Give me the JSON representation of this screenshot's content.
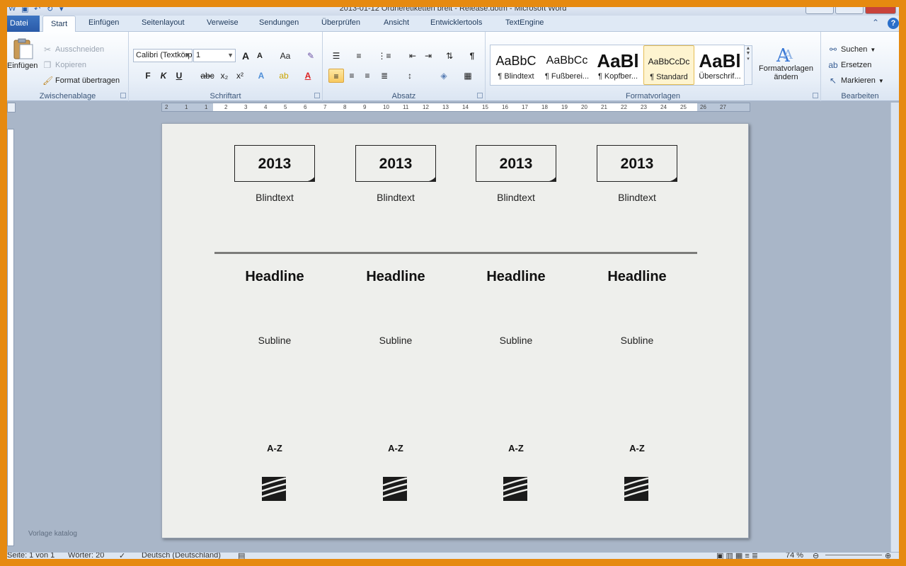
{
  "window": {
    "title": "2013-01-12 Ordneretiketten breit - Release.dotm - Microsoft Word"
  },
  "tabs": [
    {
      "label": "Datei"
    },
    {
      "label": "Start"
    },
    {
      "label": "Einfügen"
    },
    {
      "label": "Seitenlayout"
    },
    {
      "label": "Verweise"
    },
    {
      "label": "Sendungen"
    },
    {
      "label": "Überprüfen"
    },
    {
      "label": "Ansicht"
    },
    {
      "label": "Entwicklertools"
    },
    {
      "label": "TextEngine"
    }
  ],
  "ribbon": {
    "clipboard": {
      "group_label": "Zwischenablage",
      "paste_label": "Einfügen",
      "cut_label": "Ausschneiden",
      "copy_label": "Kopieren",
      "format_painter_label": "Format übertragen"
    },
    "font": {
      "group_label": "Schriftart",
      "font_name": "Calibri (Textkörper)",
      "font_size": "1",
      "bold": "F",
      "italic": "K",
      "underline": "U",
      "strike": "abc",
      "subscript": "x₂",
      "superscript": "x²",
      "change_case": "Aa",
      "grow": "A",
      "shrink": "A"
    },
    "paragraph": {
      "group_label": "Absatz",
      "pilcrow": "¶"
    },
    "styles": {
      "group_label": "Formatvorlagen",
      "items": [
        {
          "sample": "AaBbC",
          "name": "¶ Blindtext"
        },
        {
          "sample": "AaBbCc",
          "name": "¶ Fußberei..."
        },
        {
          "sample": "AaBl",
          "name": "¶ Kopfber..."
        },
        {
          "sample": "AaBbCcDc",
          "name": "¶ Standard"
        },
        {
          "sample": "AaBl",
          "name": "Überschrif..."
        }
      ],
      "change_styles_label_1": "Formatvorlagen",
      "change_styles_label_2": "ändern"
    },
    "editing": {
      "group_label": "Bearbeiten",
      "find_label": "Suchen",
      "replace_label": "Ersetzen",
      "select_label": "Markieren"
    }
  },
  "ruler": {
    "numbers": [
      "2",
      "1",
      "1",
      "2",
      "3",
      "4",
      "5",
      "6",
      "7",
      "8",
      "9",
      "10",
      "11",
      "12",
      "13",
      "14",
      "15",
      "16",
      "17",
      "18",
      "19",
      "20",
      "21",
      "22",
      "23",
      "24",
      "25",
      "26",
      "27"
    ]
  },
  "document": {
    "labels": [
      {
        "year": "2013",
        "blindtext": "Blindtext",
        "headline": "Headline",
        "subline": "Subline",
        "az": "A-Z"
      },
      {
        "year": "2013",
        "blindtext": "Blindtext",
        "headline": "Headline",
        "subline": "Subline",
        "az": "A-Z"
      },
      {
        "year": "2013",
        "blindtext": "Blindtext",
        "headline": "Headline",
        "subline": "Subline",
        "az": "A-Z"
      },
      {
        "year": "2013",
        "blindtext": "Blindtext",
        "headline": "Headline",
        "subline": "Subline",
        "az": "A-Z"
      }
    ]
  },
  "watermark": "Vorlage katalog",
  "statusbar": {
    "page": "Seite: 1 von 1",
    "words": "Wörter: 20",
    "language": "Deutsch (Deutschland)",
    "zoom": "74 %"
  }
}
